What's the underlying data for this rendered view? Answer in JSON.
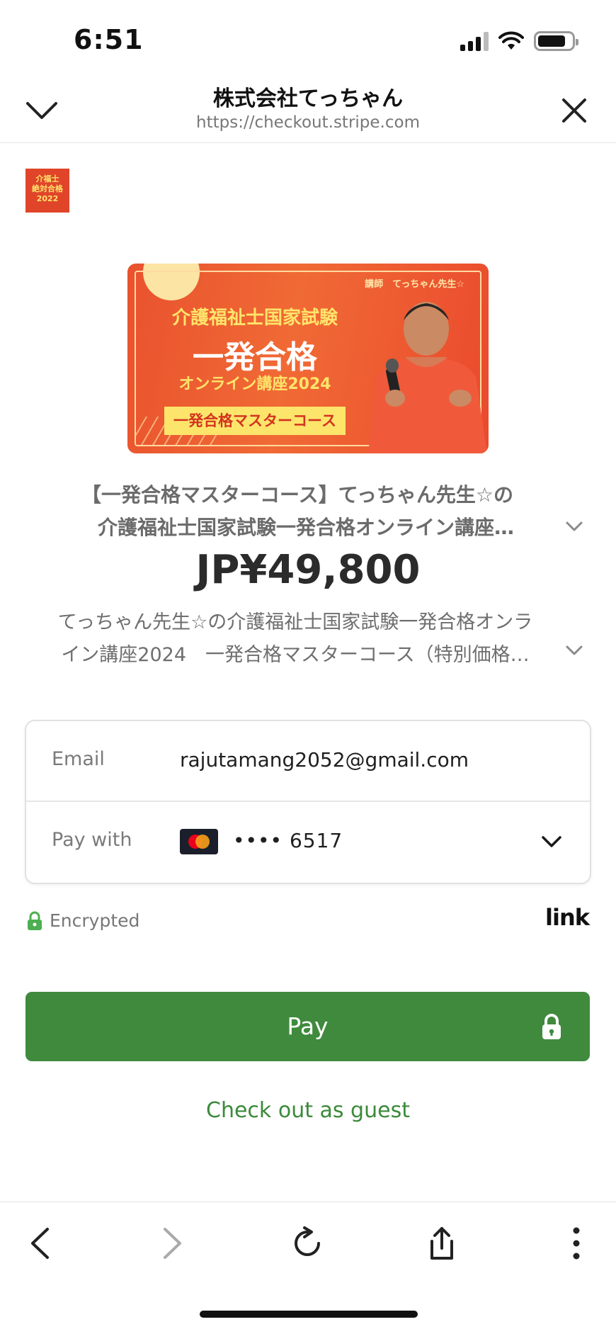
{
  "status_bar": {
    "time": "6:51"
  },
  "header": {
    "title": "株式会社てっちゃん",
    "url": "https://checkout.stripe.com"
  },
  "merchant_logo": {
    "line1": "介福士",
    "line2": "絶対合格",
    "line3": "2022"
  },
  "banner": {
    "teacher": "講師　てっちゃん先生☆",
    "line1": "介護福祉士国家試験",
    "line2": "一発合格",
    "line3": "オンライン講座2024",
    "badge": "一発合格マスターコース"
  },
  "product": {
    "title_line1": "【一発合格マスターコース】てっちゃん先生☆の",
    "title_line2": "介護福祉士国家試験一発合格オンライン講座…",
    "price": "JP¥49,800",
    "desc_line1": "てっちゃん先生☆の介護福祉士国家試験一発合格オンラ",
    "desc_line2": "イン講座2024　一発合格マスターコース（特別価格…"
  },
  "payment": {
    "email_label": "Email",
    "email_value": "rajutamang2052@gmail.com",
    "pay_with_label": "Pay with",
    "card_number": "•••• 6517",
    "card_brand": "mastercard-icon"
  },
  "encrypted_label": "Encrypted",
  "link_logo": "link",
  "pay_button_label": "Pay",
  "guest_link": "Check out as guest",
  "colors": {
    "accent_green": "#3f8a3d",
    "link_green": "#3b8a3a",
    "banner_orange": "#e9522e"
  }
}
